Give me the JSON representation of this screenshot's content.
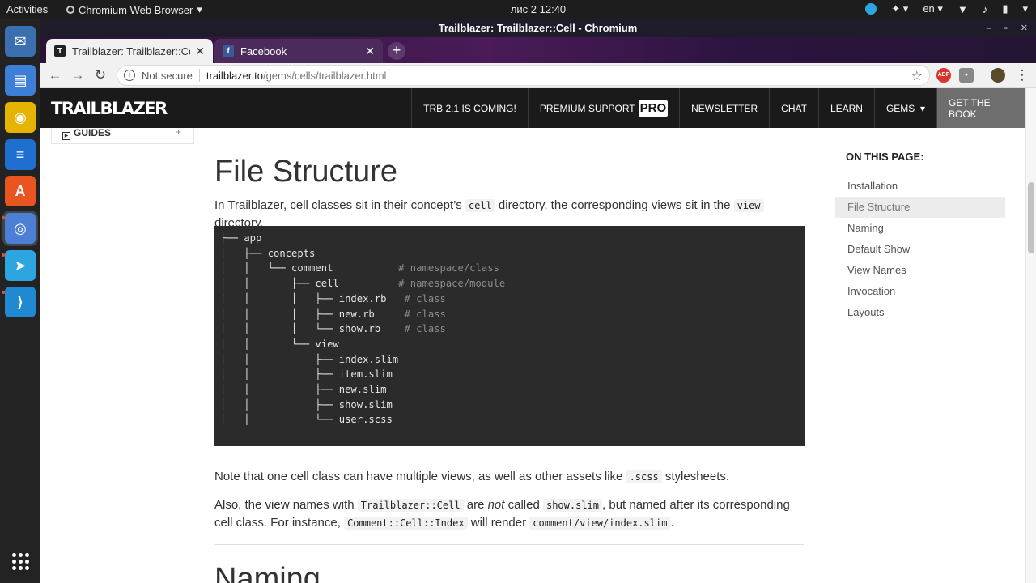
{
  "os": {
    "activities": "Activities",
    "app_menu": "Chromium Web Browser",
    "app_menu_arrow": "▾",
    "clock": "лис 2  12:40",
    "lang": "en",
    "dock_items": [
      {
        "name": "thunderbird-icon",
        "color": "#3a6fb0"
      },
      {
        "name": "files-icon",
        "color": "#3d7ed6"
      },
      {
        "name": "rhythmbox-icon",
        "color": "#e5b300"
      },
      {
        "name": "writer-icon",
        "color": "#1f6fd1"
      },
      {
        "name": "software-icon",
        "color": "#e95420"
      },
      {
        "name": "chromium-icon",
        "color": "#4c7fd6"
      },
      {
        "name": "telegram-icon",
        "color": "#2ca5e0"
      },
      {
        "name": "vscode-icon",
        "color": "#1f8ad2"
      }
    ]
  },
  "browser": {
    "window_title": "Trailblazer: Trailblazer::Cell - Chromium",
    "tabs": [
      {
        "title": "Trailblazer: Trailblazer::Ce",
        "favicon": "T"
      },
      {
        "title": "Facebook",
        "favicon": "f"
      }
    ],
    "close_glyph": "✕",
    "new_tab_glyph": "+",
    "security_label": "Not secure",
    "url_host": "trailblazer.to",
    "url_path": "/gems/cells/trailblazer.html",
    "ext_abp": "ABP"
  },
  "site": {
    "logo": "TRAILBLAZER",
    "nav": {
      "trb": "TRB 2.1 IS COMING!",
      "premium": "PREMIUM SUPPORT",
      "pro": "PRO",
      "newsletter": "NEWSLETTER",
      "chat": "CHAT",
      "learn": "LEARN",
      "gems": "GEMS",
      "gems_arrow": "▾",
      "book": "GET THE BOOK"
    },
    "sidebar": {
      "guides": "GUIDES",
      "plus": "+"
    }
  },
  "content": {
    "heading": "File Structure",
    "intro": {
      "t1": "In Trailblazer, cell classes sit in their concept’s ",
      "c1": "cell",
      "t2": " directory, the corresponding views sit in the ",
      "c2": "view",
      "t3": " directory."
    },
    "tree": [
      {
        "text": "├── app",
        "comment": ""
      },
      {
        "text": "│   ├── concepts",
        "comment": ""
      },
      {
        "text": "│   │   └── comment",
        "comment": "           # namespace/class"
      },
      {
        "text": "│   │       ├── cell",
        "comment": "          # namespace/module"
      },
      {
        "text": "│   │       │   ├── index.rb",
        "comment": "   # class"
      },
      {
        "text": "│   │       │   ├── new.rb",
        "comment": "     # class"
      },
      {
        "text": "│   │       │   └── show.rb",
        "comment": "    # class"
      },
      {
        "text": "│   │       └── view",
        "comment": ""
      },
      {
        "text": "│   │           ├── index.slim",
        "comment": ""
      },
      {
        "text": "│   │           ├── item.slim",
        "comment": ""
      },
      {
        "text": "│   │           ├── new.slim",
        "comment": ""
      },
      {
        "text": "│   │           ├── show.slim",
        "comment": ""
      },
      {
        "text": "│   │           └── user.scss",
        "comment": ""
      }
    ],
    "note": {
      "t1": "Note that one cell class can have multiple views, as well as other assets like ",
      "c1": ".scss",
      "t2": " stylesheets."
    },
    "also": {
      "t1": "Also, the view names with ",
      "c1": "Trailblazer::Cell",
      "t2": " are ",
      "em": "not",
      "t3": " called ",
      "c2": "show.slim",
      "t4": ", but named after its corresponding cell class. For instance, ",
      "c3": "Comment::Cell::Index",
      "t5": " will render ",
      "c4": "comment/view/index.slim",
      "t6": "."
    },
    "next_heading": "Naming"
  },
  "toc": {
    "title": "ON THIS PAGE:",
    "items": [
      "Installation",
      "File Structure",
      "Naming",
      "Default Show",
      "View Names",
      "Invocation",
      "Layouts"
    ],
    "current": "File Structure"
  }
}
